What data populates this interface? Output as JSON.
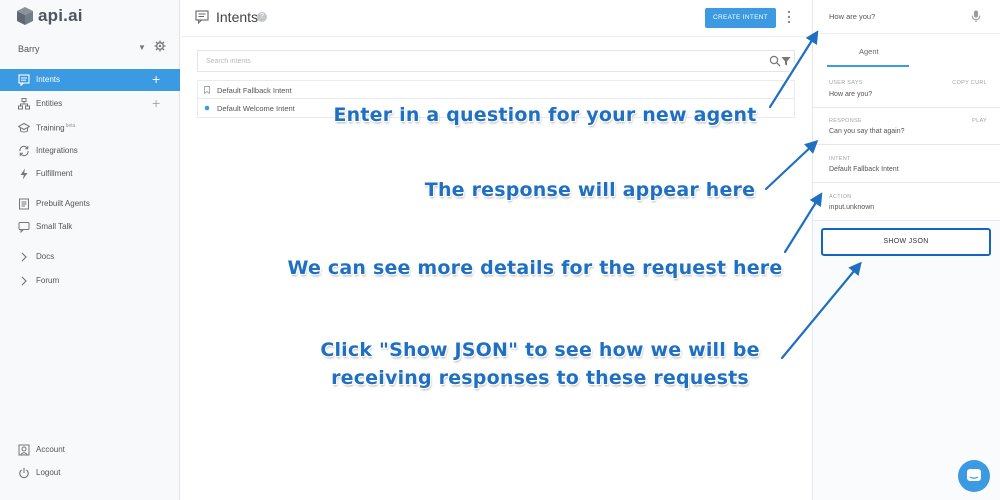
{
  "brand": {
    "name": "api.ai",
    "accent": "#3b9ae1",
    "annotation_color": "#1f6fc2",
    "outline_color": "#1565c0"
  },
  "sidebar": {
    "agent_name": "Barry",
    "items": [
      {
        "label": "Intents",
        "icon": "intents-icon",
        "active": true,
        "has_add": true
      },
      {
        "label": "Entities",
        "icon": "entities-icon",
        "active": false,
        "has_add": true
      },
      {
        "label": "Training",
        "badge": "beta",
        "icon": "training-icon",
        "active": false,
        "has_add": false
      },
      {
        "label": "Integrations",
        "icon": "integrations-icon",
        "active": false,
        "has_add": false
      },
      {
        "label": "Fulfillment",
        "icon": "fulfillment-icon",
        "active": false,
        "has_add": false
      },
      {
        "label": "Prebuilt Agents",
        "icon": "prebuilt-agents-icon",
        "active": false,
        "has_add": false
      },
      {
        "label": "Small Talk",
        "icon": "small-talk-icon",
        "active": false,
        "has_add": false
      },
      {
        "label": "Docs",
        "icon": "chevron-right-icon",
        "active": false,
        "has_add": false
      },
      {
        "label": "Forum",
        "icon": "chevron-right-icon",
        "active": false,
        "has_add": false
      }
    ],
    "footer": [
      {
        "label": "Account",
        "icon": "account-icon"
      },
      {
        "label": "Logout",
        "icon": "logout-icon"
      }
    ]
  },
  "header": {
    "title": "Intents",
    "help": "?",
    "create_button": "CREATE INTENT"
  },
  "search": {
    "placeholder": "Search intents"
  },
  "intents": [
    {
      "label": "Default Fallback Intent",
      "icon": "bookmark-icon"
    },
    {
      "label": "Default Welcome Intent",
      "icon": "dot-icon"
    }
  ],
  "console": {
    "query": "How are you?",
    "tab": "Agent",
    "user_says_key": "USER SAYS",
    "copy_curl": "COPY CURL",
    "user_says_value": "How are you?",
    "response_key": "RESPONSE",
    "play": "PLAY",
    "response_value": "Can you say that again?",
    "intent_key": "INTENT",
    "intent_value": "Default Fallback Intent",
    "action_key": "ACTION",
    "action_value": "input.unknown",
    "show_json": "SHOW JSON"
  },
  "annotations": {
    "a1": "Enter in a question for your new agent",
    "a2": "The response will appear here",
    "a3": "We can see more details for the request here",
    "a4_line1": "Click \"Show JSON\" to see how we will be",
    "a4_line2": "receiving responses to these requests"
  }
}
